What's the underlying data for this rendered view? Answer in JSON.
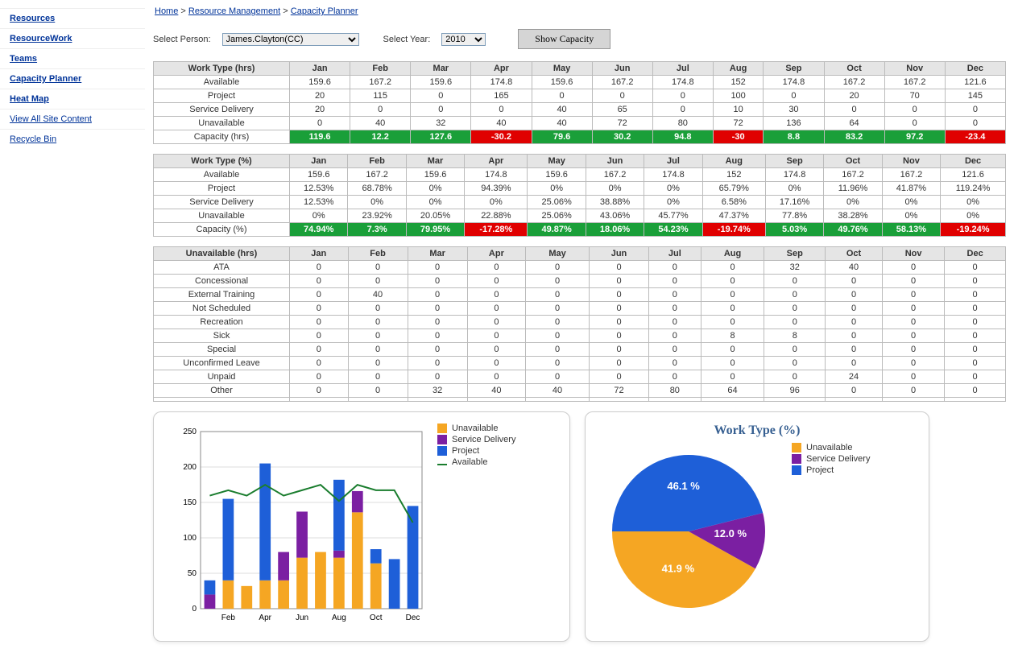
{
  "breadcrumbs": [
    {
      "label": "Home"
    },
    {
      "label": "Resource Management"
    },
    {
      "label": "Capacity Planner"
    }
  ],
  "sidebar": [
    {
      "label": "Resources"
    },
    {
      "label": "ResourceWork"
    },
    {
      "label": "Teams"
    },
    {
      "label": "Capacity Planner"
    },
    {
      "label": "Heat Map"
    },
    {
      "label": "View All Site Content",
      "sub": true
    },
    {
      "label": "Recycle Bin",
      "sub": true
    }
  ],
  "controls": {
    "personLabel": "Select Person:",
    "person": "James.Clayton(CC)",
    "yearLabel": "Select Year:",
    "year": "2010",
    "showBtn": "Show Capacity"
  },
  "months": [
    "Jan",
    "Feb",
    "Mar",
    "Apr",
    "May",
    "Jun",
    "Jul",
    "Aug",
    "Sep",
    "Oct",
    "Nov",
    "Dec"
  ],
  "tables": [
    {
      "title": "Work Type (hrs)",
      "rows": [
        {
          "l": "Available",
          "v": [
            "159.6",
            "167.2",
            "159.6",
            "174.8",
            "159.6",
            "167.2",
            "174.8",
            "152",
            "174.8",
            "167.2",
            "167.2",
            "121.6"
          ]
        },
        {
          "l": "Project",
          "v": [
            "20",
            "115",
            "0",
            "165",
            "0",
            "0",
            "0",
            "100",
            "0",
            "20",
            "70",
            "145"
          ]
        },
        {
          "l": "Service Delivery",
          "v": [
            "20",
            "0",
            "0",
            "0",
            "40",
            "65",
            "0",
            "10",
            "30",
            "0",
            "0",
            "0"
          ]
        },
        {
          "l": "Unavailable",
          "v": [
            "0",
            "40",
            "32",
            "40",
            "40",
            "72",
            "80",
            "72",
            "136",
            "64",
            "0",
            "0"
          ]
        },
        {
          "l": "Capacity (hrs)",
          "cap": true,
          "v": [
            "119.6",
            "12.2",
            "127.6",
            "-30.2",
            "79.6",
            "30.2",
            "94.8",
            "-30",
            "8.8",
            "83.2",
            "97.2",
            "-23.4"
          ]
        }
      ]
    },
    {
      "title": "Work Type (%)",
      "rows": [
        {
          "l": "Available",
          "v": [
            "159.6",
            "167.2",
            "159.6",
            "174.8",
            "159.6",
            "167.2",
            "174.8",
            "152",
            "174.8",
            "167.2",
            "167.2",
            "121.6"
          ]
        },
        {
          "l": "Project",
          "v": [
            "12.53%",
            "68.78%",
            "0%",
            "94.39%",
            "0%",
            "0%",
            "0%",
            "65.79%",
            "0%",
            "11.96%",
            "41.87%",
            "119.24%"
          ]
        },
        {
          "l": "Service Delivery",
          "v": [
            "12.53%",
            "0%",
            "0%",
            "0%",
            "25.06%",
            "38.88%",
            "0%",
            "6.58%",
            "17.16%",
            "0%",
            "0%",
            "0%"
          ]
        },
        {
          "l": "Unavailable",
          "v": [
            "0%",
            "23.92%",
            "20.05%",
            "22.88%",
            "25.06%",
            "43.06%",
            "45.77%",
            "47.37%",
            "77.8%",
            "38.28%",
            "0%",
            "0%"
          ]
        },
        {
          "l": "Capacity (%)",
          "cap": true,
          "v": [
            "74.94%",
            "7.3%",
            "79.95%",
            "-17.28%",
            "49.87%",
            "18.06%",
            "54.23%",
            "-19.74%",
            "5.03%",
            "49.76%",
            "58.13%",
            "-19.24%"
          ]
        }
      ]
    },
    {
      "title": "Unavailable (hrs)",
      "rows": [
        {
          "l": "ATA",
          "v": [
            "0",
            "0",
            "0",
            "0",
            "0",
            "0",
            "0",
            "0",
            "32",
            "40",
            "0",
            "0"
          ]
        },
        {
          "l": "Concessional",
          "v": [
            "0",
            "0",
            "0",
            "0",
            "0",
            "0",
            "0",
            "0",
            "0",
            "0",
            "0",
            "0"
          ]
        },
        {
          "l": "External Training",
          "v": [
            "0",
            "40",
            "0",
            "0",
            "0",
            "0",
            "0",
            "0",
            "0",
            "0",
            "0",
            "0"
          ]
        },
        {
          "l": "Not Scheduled",
          "v": [
            "0",
            "0",
            "0",
            "0",
            "0",
            "0",
            "0",
            "0",
            "0",
            "0",
            "0",
            "0"
          ]
        },
        {
          "l": "Recreation",
          "v": [
            "0",
            "0",
            "0",
            "0",
            "0",
            "0",
            "0",
            "0",
            "0",
            "0",
            "0",
            "0"
          ]
        },
        {
          "l": "Sick",
          "v": [
            "0",
            "0",
            "0",
            "0",
            "0",
            "0",
            "0",
            "8",
            "8",
            "0",
            "0",
            "0"
          ]
        },
        {
          "l": "Special",
          "v": [
            "0",
            "0",
            "0",
            "0",
            "0",
            "0",
            "0",
            "0",
            "0",
            "0",
            "0",
            "0"
          ]
        },
        {
          "l": "Unconfirmed Leave",
          "v": [
            "0",
            "0",
            "0",
            "0",
            "0",
            "0",
            "0",
            "0",
            "0",
            "0",
            "0",
            "0"
          ]
        },
        {
          "l": "Unpaid",
          "v": [
            "0",
            "0",
            "0",
            "0",
            "0",
            "0",
            "0",
            "0",
            "0",
            "24",
            "0",
            "0"
          ]
        },
        {
          "l": "Other",
          "v": [
            "0",
            "0",
            "32",
            "40",
            "40",
            "72",
            "80",
            "64",
            "96",
            "0",
            "0",
            "0"
          ]
        },
        {
          "l": "",
          "v": [
            "",
            "",
            "",
            "",
            "",
            "",
            "",
            "",
            "",
            "",
            "",
            ""
          ]
        }
      ]
    }
  ],
  "colors": {
    "unavail": "#f5a623",
    "service": "#7b1fa2",
    "project": "#1e5fd8",
    "avail": "#1a7d2e",
    "grid": "#bdbdbd"
  },
  "chart_data": [
    {
      "type": "bar",
      "ylim": [
        0,
        250
      ],
      "xlabel": "",
      "ylabel": "",
      "categories": [
        "Jan",
        "Feb",
        "Mar",
        "Apr",
        "May",
        "Jun",
        "Jul",
        "Aug",
        "Sep",
        "Oct",
        "Nov",
        "Dec"
      ],
      "series": [
        {
          "name": "Unavailable",
          "values": [
            0,
            40,
            32,
            40,
            40,
            72,
            80,
            72,
            136,
            64,
            0,
            0
          ]
        },
        {
          "name": "Service Delivery",
          "values": [
            20,
            0,
            0,
            0,
            40,
            65,
            0,
            10,
            30,
            0,
            0,
            0
          ]
        },
        {
          "name": "Project",
          "values": [
            20,
            115,
            0,
            165,
            0,
            0,
            0,
            100,
            0,
            20,
            70,
            145
          ]
        }
      ],
      "line": {
        "name": "Available",
        "values": [
          159.6,
          167.2,
          159.6,
          174.8,
          159.6,
          167.2,
          174.8,
          152,
          174.8,
          167.2,
          167.2,
          121.6
        ]
      },
      "legend": [
        "Unavailable",
        "Service Delivery",
        "Project",
        "Available"
      ]
    },
    {
      "type": "pie",
      "title": "Work Type (%)",
      "slices": [
        {
          "name": "Unavailable",
          "value": 41.9
        },
        {
          "name": "Service Delivery",
          "value": 12.0
        },
        {
          "name": "Project",
          "value": 46.1
        }
      ],
      "legend": [
        "Unavailable",
        "Service Delivery",
        "Project"
      ]
    }
  ]
}
